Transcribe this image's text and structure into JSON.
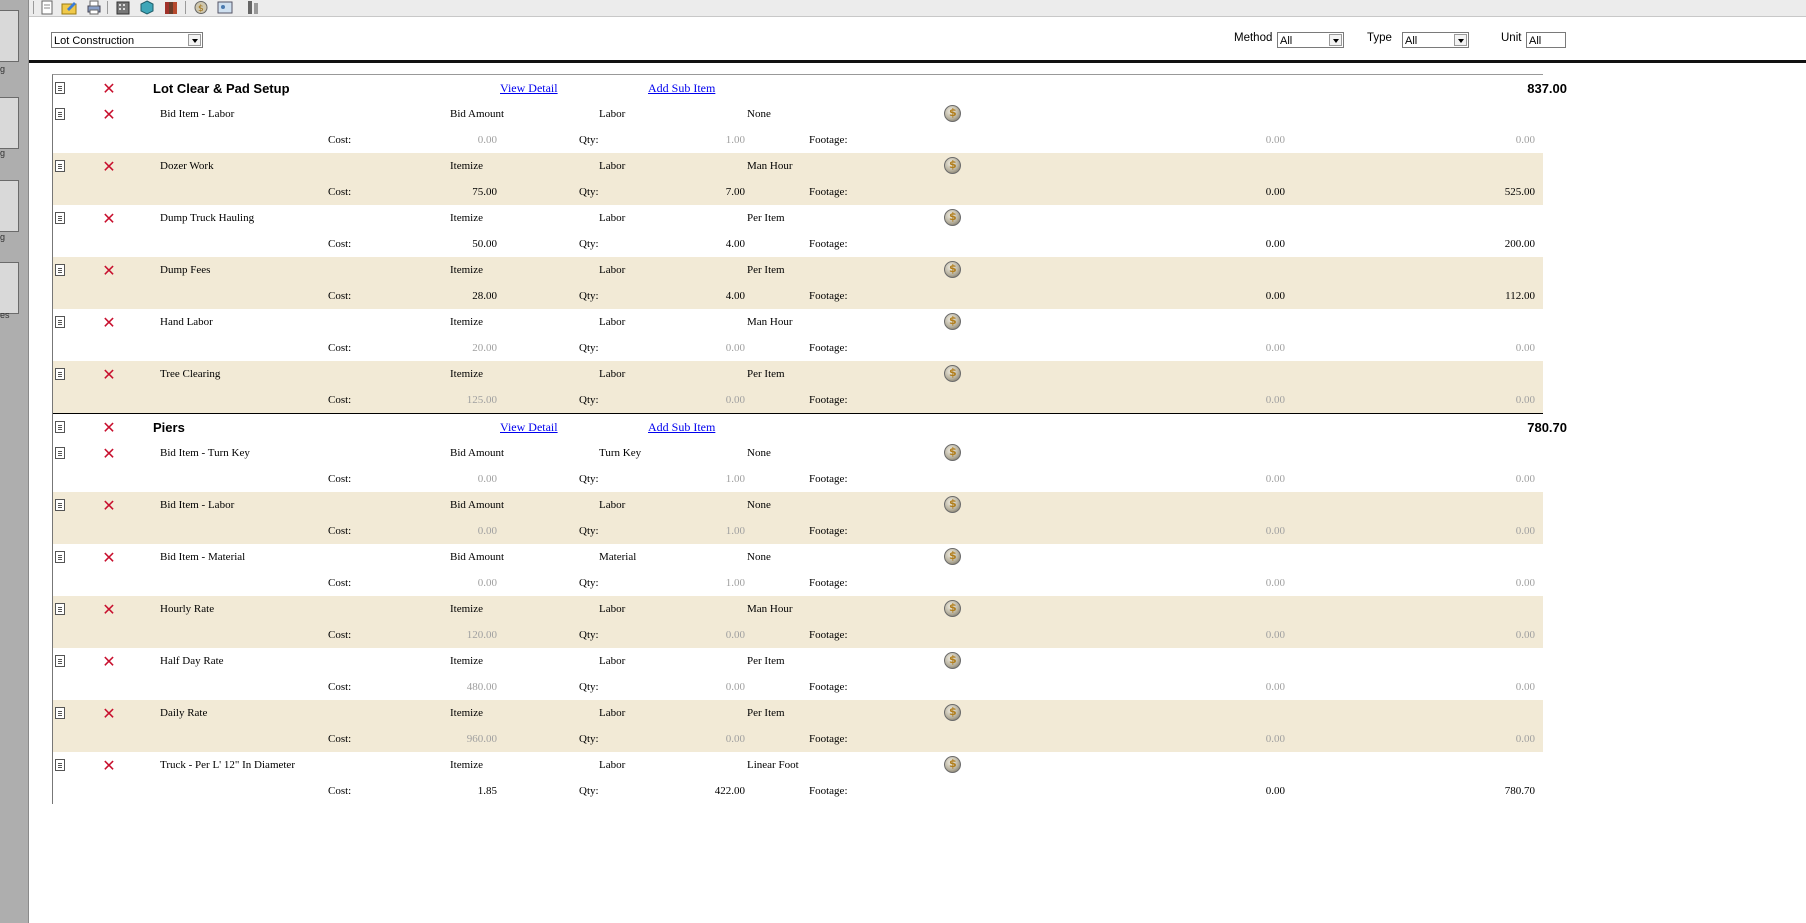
{
  "filters": {
    "category": "Lot Construction",
    "method_label": "Method",
    "method_value": "All",
    "type_label": "Type",
    "type_value": "All",
    "unit_label": "Unit",
    "unit_value": "All"
  },
  "sidebar": {
    "labels": [
      "g",
      "g",
      "es"
    ]
  },
  "toolbar": {
    "icons": [
      "new-document-icon",
      "open-folder-icon",
      "print-icon",
      "building-icon",
      "cube-icon",
      "books-icon",
      "coin-icon",
      "image-icon",
      "tools-icon"
    ]
  },
  "row_labels": {
    "cost": "Cost:",
    "qty": "Qty:",
    "footage": "Footage:"
  },
  "groups": [
    {
      "title": "Lot Clear & Pad Setup",
      "view_detail": "View Detail",
      "add_sub_item": "Add Sub Item",
      "total": "837.00",
      "items": [
        {
          "name": "Bid Item - Labor",
          "method": "Bid Amount",
          "type": "Labor",
          "unit": "None",
          "cost": "0.00",
          "qty": "1.00",
          "footage": "0.00",
          "total": "0.00",
          "active": false
        },
        {
          "name": "Dozer Work",
          "method": "Itemize",
          "type": "Labor",
          "unit": "Man Hour",
          "cost": "75.00",
          "qty": "7.00",
          "footage": "0.00",
          "total": "525.00",
          "active": true
        },
        {
          "name": "Dump Truck Hauling",
          "method": "Itemize",
          "type": "Labor",
          "unit": "Per Item",
          "cost": "50.00",
          "qty": "4.00",
          "footage": "0.00",
          "total": "200.00",
          "active": true
        },
        {
          "name": "Dump Fees",
          "method": "Itemize",
          "type": "Labor",
          "unit": "Per Item",
          "cost": "28.00",
          "qty": "4.00",
          "footage": "0.00",
          "total": "112.00",
          "active": true
        },
        {
          "name": "Hand Labor",
          "method": "Itemize",
          "type": "Labor",
          "unit": "Man Hour",
          "cost": "20.00",
          "qty": "0.00",
          "footage": "0.00",
          "total": "0.00",
          "active": false
        },
        {
          "name": "Tree Clearing",
          "method": "Itemize",
          "type": "Labor",
          "unit": "Per Item",
          "cost": "125.00",
          "qty": "0.00",
          "footage": "0.00",
          "total": "0.00",
          "active": false
        }
      ]
    },
    {
      "title": "Piers",
      "view_detail": "View Detail",
      "add_sub_item": "Add Sub Item",
      "total": "780.70",
      "items": [
        {
          "name": "Bid Item - Turn Key",
          "method": "Bid Amount",
          "type": "Turn Key",
          "unit": "None",
          "cost": "0.00",
          "qty": "1.00",
          "footage": "0.00",
          "total": "0.00",
          "active": false
        },
        {
          "name": "Bid Item - Labor",
          "method": "Bid Amount",
          "type": "Labor",
          "unit": "None",
          "cost": "0.00",
          "qty": "1.00",
          "footage": "0.00",
          "total": "0.00",
          "active": false
        },
        {
          "name": "Bid Item - Material",
          "method": "Bid Amount",
          "type": "Material",
          "unit": "None",
          "cost": "0.00",
          "qty": "1.00",
          "footage": "0.00",
          "total": "0.00",
          "active": false
        },
        {
          "name": "Hourly Rate",
          "method": "Itemize",
          "type": "Labor",
          "unit": "Man Hour",
          "cost": "120.00",
          "qty": "0.00",
          "footage": "0.00",
          "total": "0.00",
          "active": false
        },
        {
          "name": "Half Day Rate",
          "method": "Itemize",
          "type": "Labor",
          "unit": "Per Item",
          "cost": "480.00",
          "qty": "0.00",
          "footage": "0.00",
          "total": "0.00",
          "active": false
        },
        {
          "name": "Daily Rate",
          "method": "Itemize",
          "type": "Labor",
          "unit": "Per Item",
          "cost": "960.00",
          "qty": "0.00",
          "footage": "0.00",
          "total": "0.00",
          "active": false
        },
        {
          "name": "Truck - Per L' 12\" In Diameter",
          "method": "Itemize",
          "type": "Labor",
          "unit": "Linear Foot",
          "cost": "1.85",
          "qty": "422.00",
          "footage": "0.00",
          "total": "780.70",
          "active": true
        }
      ]
    }
  ]
}
